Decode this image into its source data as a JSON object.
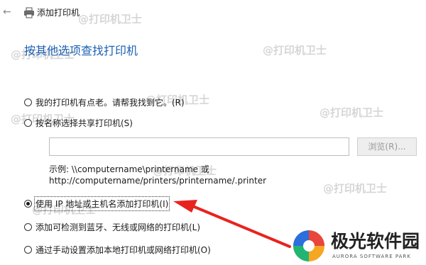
{
  "window": {
    "title": "添加打印机"
  },
  "page": {
    "heading": "按其他选项查找打印机"
  },
  "options": [
    {
      "label": "我的打印机有点老。请帮我找到它。(R)",
      "checked": false
    },
    {
      "label": "按名称选择共享打印机(S)",
      "checked": false
    },
    {
      "label": "使用 IP 地址或主机名添加打印机(I)",
      "checked": true
    },
    {
      "label": "添加可检测到蓝牙、无线或网络的打印机(L)",
      "checked": false
    },
    {
      "label": "通过手动设置添加本地打印机或网络打印机(O)",
      "checked": false
    }
  ],
  "shared_printer": {
    "input_value": "",
    "browse_label": "浏览(R)...",
    "example_line1": "示例: \\\\computername\\printername 或",
    "example_line2": "http://computername/printers/printername/.printer"
  },
  "watermark": {
    "text": "@打印机卫士"
  },
  "logo": {
    "name": "极光软件园",
    "sub": "AURORA SOFTWARE PARK"
  },
  "colors": {
    "heading": "#1c5fb3",
    "arrow": "#e8231f"
  }
}
